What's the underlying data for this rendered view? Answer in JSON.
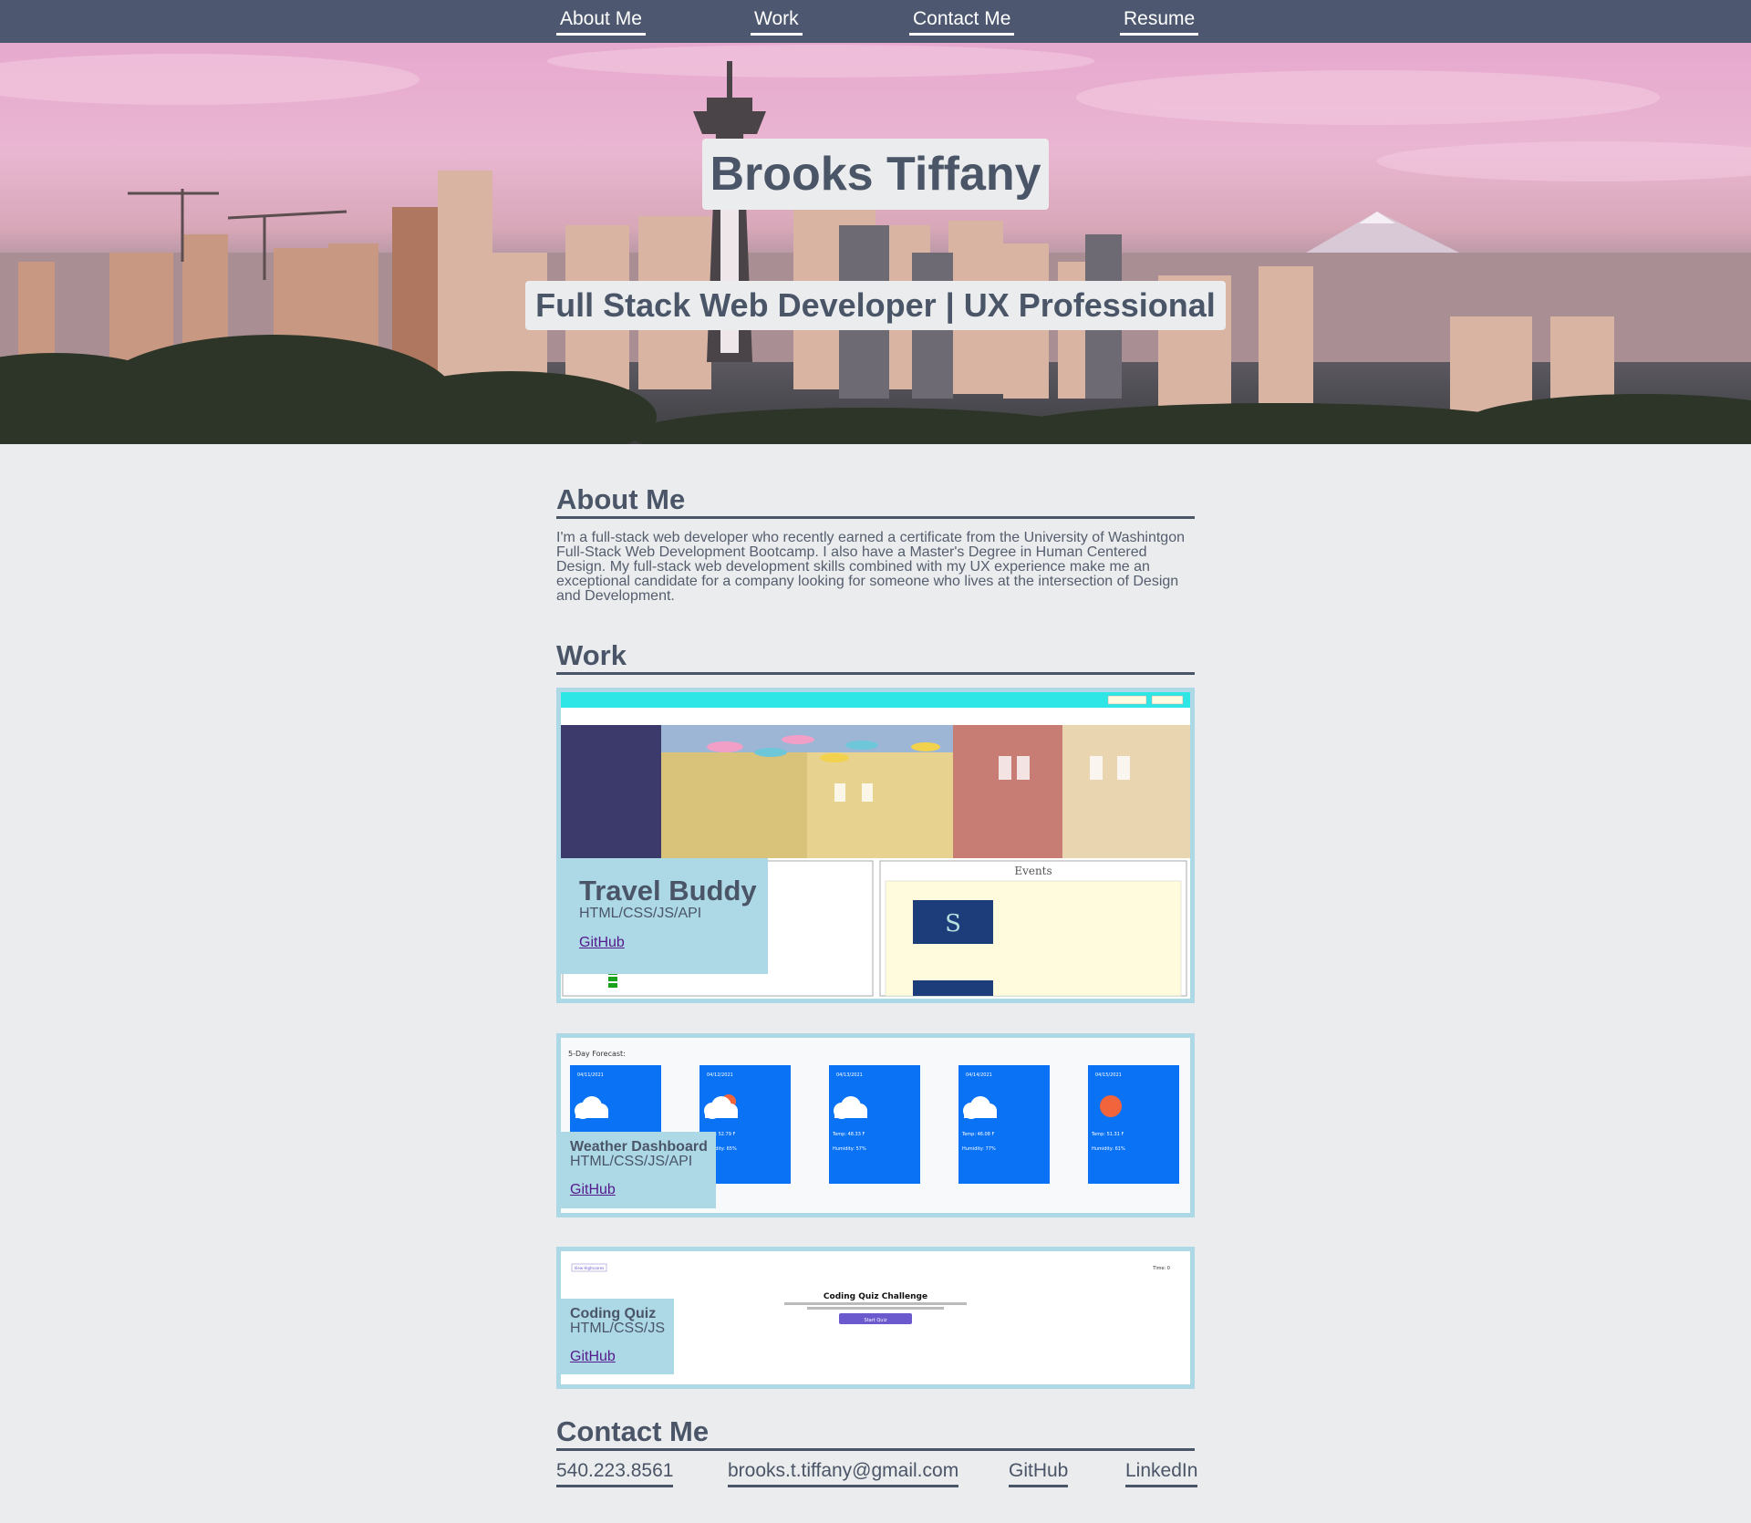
{
  "nav": {
    "about": "About Me",
    "work": "Work",
    "contact": "Contact Me",
    "resume": "Resume"
  },
  "hero": {
    "name": "Brooks Tiffany",
    "tagline": "Full Stack Web Developer | UX Professional"
  },
  "about": {
    "heading": "About Me",
    "body": "I'm a full-stack web developer who recently earned a certificate from the University of Washintgon Full-Stack Web Development Bootcamp. I also have a Master's Degree in Human Centered Design. My full-stack web development skills combined with my UX experience make me an exceptional candidate for a company looking for someone who lives at the intersection of Design and Development."
  },
  "work": {
    "heading": "Work",
    "projects": [
      {
        "title": "Travel Buddy",
        "stack": "HTML/CSS/JS/API",
        "link": "GitHub",
        "preview": {
          "events_heading": "Events"
        }
      },
      {
        "title": "Weather Dashboard",
        "stack": "HTML/CSS/JS/API",
        "link": "GitHub",
        "preview": {
          "forecast_heading": "5-Day Forecast:",
          "days": [
            {
              "date": "04/11/2021",
              "temp": "",
              "humidity": "",
              "icon": "cloud-icon"
            },
            {
              "date": "04/12/2021",
              "temp": "Temp: 52.79 F",
              "humidity": "Humidity: 65%",
              "icon": "rain-sun-icon"
            },
            {
              "date": "04/13/2021",
              "temp": "Temp: 48.33 F",
              "humidity": "Humidity: 57%",
              "icon": "cloud-icon"
            },
            {
              "date": "04/14/2021",
              "temp": "Temp: 46.08 F",
              "humidity": "Humidity: 77%",
              "icon": "cloud-icon"
            },
            {
              "date": "04/15/2021",
              "temp": "Temp: 51.31 F",
              "humidity": "Humidity: 61%",
              "icon": "sun-icon"
            }
          ]
        }
      },
      {
        "title": "Coding Quiz",
        "stack": "HTML/CSS/JS",
        "link": "GitHub",
        "preview": {
          "highscores": "View Highscores",
          "timer": "Time: 0",
          "heading": "Coding Quiz Challenge",
          "button": "Start Quiz"
        }
      }
    ]
  },
  "contact": {
    "heading": "Contact Me",
    "phone": "540.223.8561",
    "email": "brooks.t.tiffany@gmail.com",
    "github": "GitHub",
    "linkedin": "LinkedIn"
  },
  "colors": {
    "nav_bg": "#4d5870",
    "page_bg": "#ebeced",
    "heading": "#4a5568",
    "card_border": "#add8e6",
    "weather_card": "#0a72f5",
    "quiz_button": "#6a5acd"
  }
}
